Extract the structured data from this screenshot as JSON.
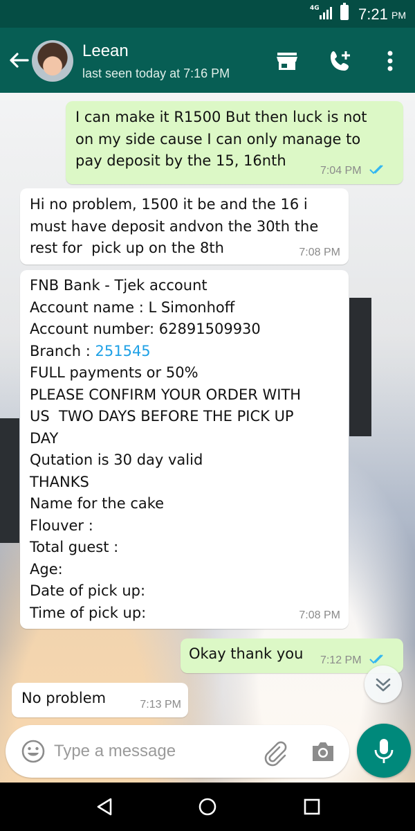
{
  "status_bar": {
    "network": "4G",
    "time": "7:21",
    "ampm": "PM"
  },
  "header": {
    "contact_name": "Leean",
    "last_seen": "last seen today at 7:16 PM",
    "icons": [
      "back-arrow-icon",
      "shop-icon",
      "add-call-icon",
      "more-vert-icon"
    ]
  },
  "messages": [
    {
      "direction": "out",
      "lines": [
        "I can make it R1500 But then luck is not",
        "on my side cause I can only manage to",
        "pay deposit by the 15, 16nth"
      ],
      "time": "7:04 PM",
      "status": "read"
    },
    {
      "direction": "in",
      "lines": [
        "Hi no problem, 1500 it be and the 16 i",
        "must have deposit andvon the 30th the",
        "rest for  pick up on the 8th"
      ],
      "time": "7:08 PM"
    },
    {
      "direction": "in",
      "lines": [
        "FNB Bank - Tjek account",
        "Account name : L Simonhoff",
        "Account number: 62891509930",
        "Branch : ",
        "FULL payments or 50%",
        "PLEASE CONFIRM YOUR ORDER WITH",
        "US  TWO DAYS BEFORE THE PICK UP",
        "DAY",
        "Qutation is 30 day valid",
        "THANKS",
        "Name for the cake",
        "Flouver :",
        "Total guest :",
        "Age:",
        "Date of pick up:",
        "Time of pick up:"
      ],
      "branch_link": "251545",
      "time": "7:08 PM"
    },
    {
      "direction": "out",
      "lines": [
        "Okay thank you"
      ],
      "time": "7:12 PM",
      "status": "read"
    },
    {
      "direction": "in",
      "lines": [
        "No problem"
      ],
      "time": "7:13 PM"
    }
  ],
  "composer": {
    "placeholder": "Type a message",
    "icons": [
      "emoji-icon",
      "attach-icon",
      "camera-icon",
      "mic-icon"
    ]
  },
  "colors": {
    "header": "#075e54",
    "status_bar": "#054d44",
    "outgoing_bubble": "#dcf8c6",
    "incoming_bubble": "#ffffff",
    "read_ticks": "#34b7f1",
    "mic_button": "#00897b",
    "link": "#1fa1e6"
  },
  "nav_bar": {
    "icons": [
      "back-triangle-icon",
      "home-circle-icon",
      "recents-square-icon"
    ]
  }
}
